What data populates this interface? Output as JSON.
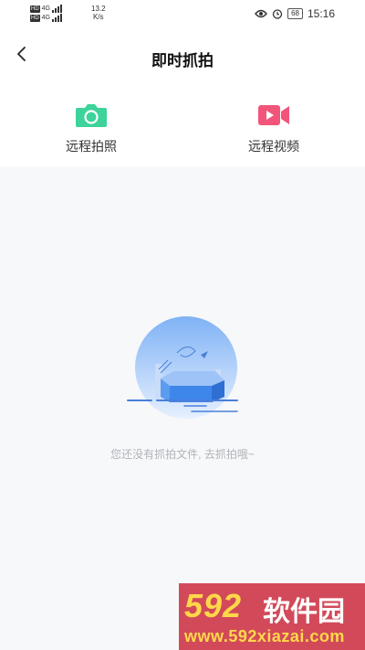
{
  "status_bar": {
    "hd1": "HD",
    "hd2": "HD",
    "net_a": "4G",
    "net_b": "4G",
    "speed_value": "13.2",
    "speed_unit": "K/s",
    "battery": "68",
    "time": "15:16"
  },
  "header": {
    "title": "即时抓拍"
  },
  "actions": [
    {
      "label": "远程拍照",
      "icon": "camera-icon",
      "color": "#3dd39a"
    },
    {
      "label": "远程视频",
      "icon": "video-camera-icon",
      "color": "#f2557a"
    }
  ],
  "empty_state": {
    "message": "您还没有抓拍文件, 去抓拍哦~"
  },
  "watermark": {
    "logo_number": "592",
    "logo_text": "软件园",
    "url": "www.592xiazai.com"
  }
}
